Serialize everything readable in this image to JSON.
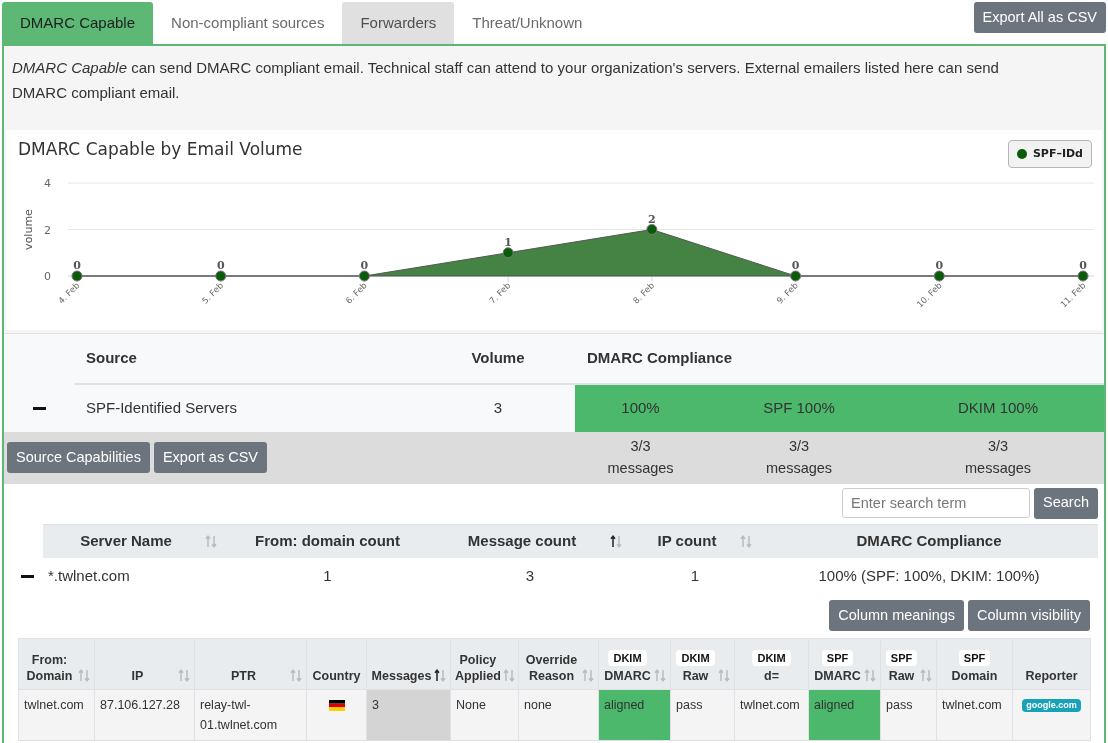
{
  "tabs": [
    {
      "label": "DMARC Capable",
      "selected": true,
      "hovered": false
    },
    {
      "label": "Non-compliant sources",
      "selected": false,
      "hovered": false
    },
    {
      "label": "Forwarders",
      "selected": false,
      "hovered": true
    },
    {
      "label": "Threat/Unknown",
      "selected": false,
      "hovered": false
    }
  ],
  "export_all_button": "Export All as CSV",
  "description": "*DMARC Capable* can send DMARC compliant email. Technical staff can attend to your organization's servers. External emailers listed here can send DMARC compliant email.",
  "chart": {
    "chart_data": {
      "type": "area",
      "title": "DMARC Capable by Email Volume",
      "ylabel": "volume",
      "categories": [
        "4. Feb",
        "5. Feb",
        "6. Feb",
        "7. Feb",
        "8. Feb",
        "9. Feb",
        "10. Feb",
        "11. Feb"
      ],
      "series": [
        {
          "name": "SPF–IDd",
          "color": "#0a5c0a",
          "values": [
            0,
            0,
            0,
            1,
            2,
            0,
            0,
            0
          ]
        }
      ],
      "ylim": [
        0,
        4
      ],
      "yticks": [
        0,
        2,
        4
      ],
      "data_labels": true
    }
  },
  "source_table": {
    "columns": [
      "Source",
      "Volume",
      "DMARC Compliance"
    ],
    "rows": [
      {
        "expanded": true,
        "source": "SPF-Identified Servers",
        "volume": "3",
        "compliance": [
          {
            "compliant": true,
            "value": "100%",
            "detail": "3/3 messages"
          },
          {
            "compliant": true,
            "value": "SPF 100%",
            "detail": "3/3 messages"
          },
          {
            "compliant": true,
            "value": "DKIM 100%",
            "detail": "3/3 messages"
          }
        ]
      }
    ],
    "buttons": [
      "Source Capabilities",
      "Export as CSV"
    ]
  },
  "search": {
    "placeholder": "Enter search term",
    "button": "Search"
  },
  "server_table": {
    "columns": [
      {
        "label": "Server Name",
        "sorted": false
      },
      {
        "label": "From: domain count"
      },
      {
        "label": "Message count",
        "sorted": true
      },
      {
        "label": "IP count",
        "sorted": false
      },
      {
        "label": "DMARC Compliance"
      }
    ],
    "rows": [
      {
        "expanded": true,
        "cells": [
          "*.twlnet.com",
          "1",
          "3",
          "1",
          "100% (SPF: 100%, DKIM: 100%)"
        ]
      }
    ]
  },
  "detail_buttons": [
    "Column meanings",
    "Column visibility"
  ],
  "detail_table": {
    "columns": [
      {
        "label": "From: Domain",
        "sorted": false
      },
      {
        "label": "IP",
        "sorted": false
      },
      {
        "label": "PTR",
        "sorted": false
      },
      {
        "label": "Country"
      },
      {
        "label": "Messages",
        "sorted": true
      },
      {
        "label": "Policy Applied",
        "sorted": false
      },
      {
        "label": "Override Reason",
        "sorted": false
      },
      {
        "tag": "DKIM",
        "label": "DMARC",
        "sorted": false
      },
      {
        "tag": "DKIM",
        "label": "Raw",
        "sorted": false
      },
      {
        "tag": "DKIM",
        "label": "d="
      },
      {
        "tag": "SPF",
        "label": "DMARC",
        "sorted": false
      },
      {
        "tag": "SPF",
        "label": "Raw",
        "sorted": false
      },
      {
        "tag": "SPF",
        "label": "Domain"
      },
      {
        "label": "Reporter"
      }
    ],
    "rows": [
      {
        "cells": [
          {
            "kind": "text",
            "text": "twlnet.com"
          },
          {
            "kind": "text",
            "text": "87.106.127.28"
          },
          {
            "kind": "text",
            "text": "relay-twl-01.twlnet.com"
          },
          {
            "kind": "flag"
          },
          {
            "kind": "text",
            "text": "3"
          },
          {
            "kind": "text",
            "text": "None"
          },
          {
            "kind": "text",
            "text": "none"
          },
          {
            "kind": "success",
            "text": "aligned"
          },
          {
            "kind": "text",
            "text": "pass"
          },
          {
            "kind": "text",
            "text": "twlnet.com"
          },
          {
            "kind": "success",
            "text": "aligned"
          },
          {
            "kind": "text",
            "text": "pass"
          },
          {
            "kind": "text",
            "text": "twlnet.com"
          },
          {
            "kind": "badge",
            "text": "google.com"
          }
        ]
      }
    ]
  }
}
